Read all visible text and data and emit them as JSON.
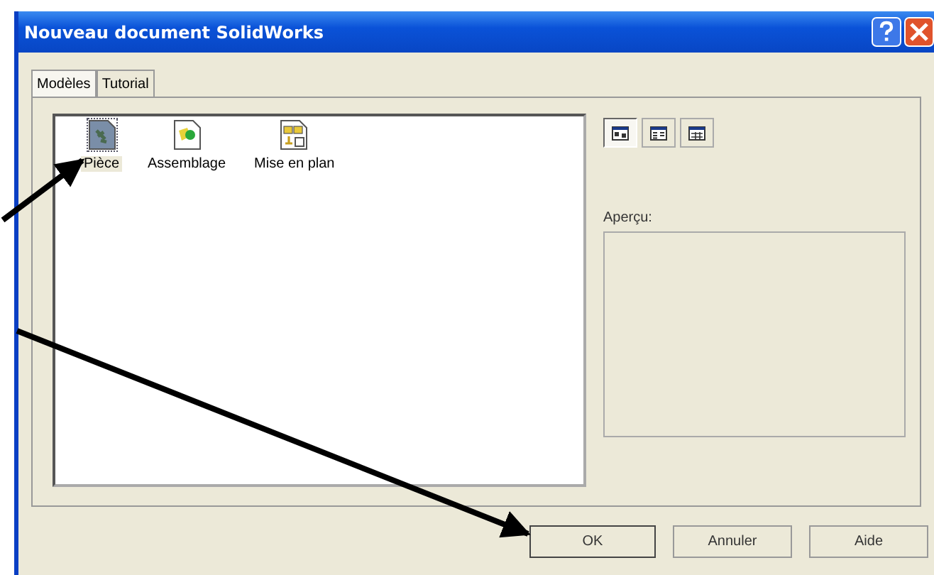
{
  "window": {
    "title": "Nouveau document SolidWorks"
  },
  "tabs": [
    {
      "label": "Modèles",
      "selected": true
    },
    {
      "label": "Tutorial",
      "selected": false
    }
  ],
  "templates": [
    {
      "label": "Pièce",
      "kind": "part",
      "selected": true
    },
    {
      "label": "Assemblage",
      "kind": "assembly",
      "selected": false
    },
    {
      "label": "Mise en plan",
      "kind": "drawing",
      "selected": false
    }
  ],
  "view_buttons": [
    {
      "kind": "large",
      "selected": true
    },
    {
      "kind": "list",
      "selected": false
    },
    {
      "kind": "details",
      "selected": false
    }
  ],
  "preview": {
    "label": "Aperçu:"
  },
  "buttons": [
    "OK",
    "Annuler",
    "Aide"
  ]
}
